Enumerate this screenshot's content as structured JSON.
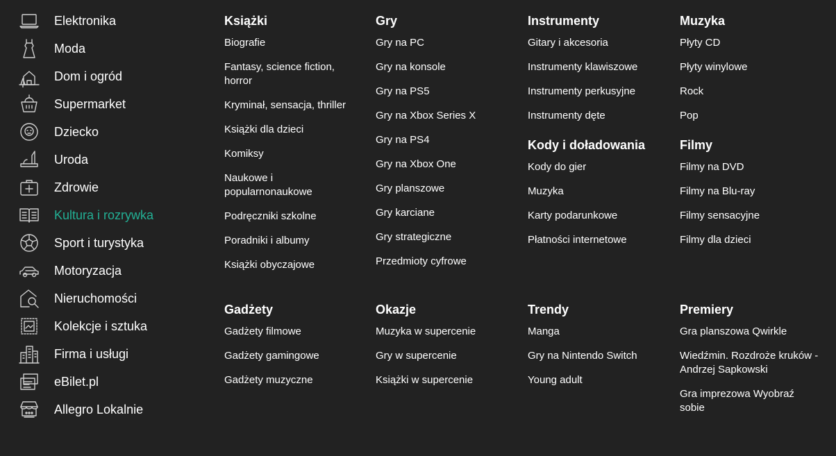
{
  "sidebar": {
    "items": [
      {
        "label": "Elektronika",
        "icon": "laptop-icon"
      },
      {
        "label": "Moda",
        "icon": "dress-icon"
      },
      {
        "label": "Dom i ogród",
        "icon": "house-tree-icon"
      },
      {
        "label": "Supermarket",
        "icon": "basket-icon"
      },
      {
        "label": "Dziecko",
        "icon": "baby-icon"
      },
      {
        "label": "Uroda",
        "icon": "lipstick-icon"
      },
      {
        "label": "Zdrowie",
        "icon": "first-aid-icon"
      },
      {
        "label": "Kultura i rozrywka",
        "icon": "book-icon",
        "active": true
      },
      {
        "label": "Sport i turystyka",
        "icon": "ball-icon"
      },
      {
        "label": "Motoryzacja",
        "icon": "car-icon"
      },
      {
        "label": "Nieruchomości",
        "icon": "house-search-icon"
      },
      {
        "label": "Kolekcje i sztuka",
        "icon": "stamp-icon"
      },
      {
        "label": "Firma i usługi",
        "icon": "building-icon"
      },
      {
        "label": "eBilet.pl",
        "icon": "ticket-icon"
      },
      {
        "label": "Allegro Lokalnie",
        "icon": "shop-icon"
      }
    ]
  },
  "columns": {
    "ksiazki": {
      "title": "Książki",
      "links": [
        "Biografie",
        "Fantasy, science fiction, horror",
        "Kryminał, sensacja, thriller",
        "Książki dla dzieci",
        "Komiksy",
        "Naukowe i popularnonaukowe",
        "Podręczniki szkolne",
        "Poradniki i albumy",
        "Książki obyczajowe"
      ]
    },
    "gry": {
      "title": "Gry",
      "links": [
        "Gry na PC",
        "Gry na konsole",
        "Gry na PS5",
        "Gry na Xbox Series X",
        "Gry na PS4",
        "Gry na Xbox One",
        "Gry planszowe",
        "Gry karciane",
        "Gry strategiczne",
        "Przedmioty cyfrowe"
      ]
    },
    "instrumenty": {
      "title": "Instrumenty",
      "links": [
        "Gitary i akcesoria",
        "Instrumenty klawiszowe",
        "Instrumenty perkusyjne",
        "Instrumenty dęte"
      ]
    },
    "kody": {
      "title": "Kody i doładowania",
      "links": [
        "Kody do gier",
        "Muzyka",
        "Karty podarunkowe",
        "Płatności internetowe"
      ]
    },
    "muzyka": {
      "title": "Muzyka",
      "links": [
        "Płyty CD",
        "Płyty winylowe",
        "Rock",
        "Pop"
      ]
    },
    "filmy": {
      "title": "Filmy",
      "links": [
        "Filmy na DVD",
        "Filmy na Blu-ray",
        "Filmy sensacyjne",
        "Filmy dla dzieci"
      ]
    },
    "gadzety": {
      "title": "Gadżety",
      "links": [
        "Gadżety filmowe",
        "Gadżety gamingowe",
        "Gadżety muzyczne"
      ]
    },
    "okazje": {
      "title": "Okazje",
      "links": [
        "Muzyka w supercenie",
        "Gry w supercenie",
        "Książki w supercenie"
      ]
    },
    "trendy": {
      "title": "Trendy",
      "links": [
        "Manga",
        "Gry na Nintendo Switch",
        "Young adult"
      ]
    },
    "premiery": {
      "title": "Premiery",
      "links": [
        "Gra planszowa Qwirkle",
        "Wiedźmin. Rozdroże kruków - Andrzej Sapkowski",
        "Gra imprezowa Wyobraź sobie"
      ]
    }
  },
  "colors": {
    "background": "#222222",
    "text": "#ffffff",
    "accent": "#22b095",
    "icon": "#cfcfcf"
  }
}
